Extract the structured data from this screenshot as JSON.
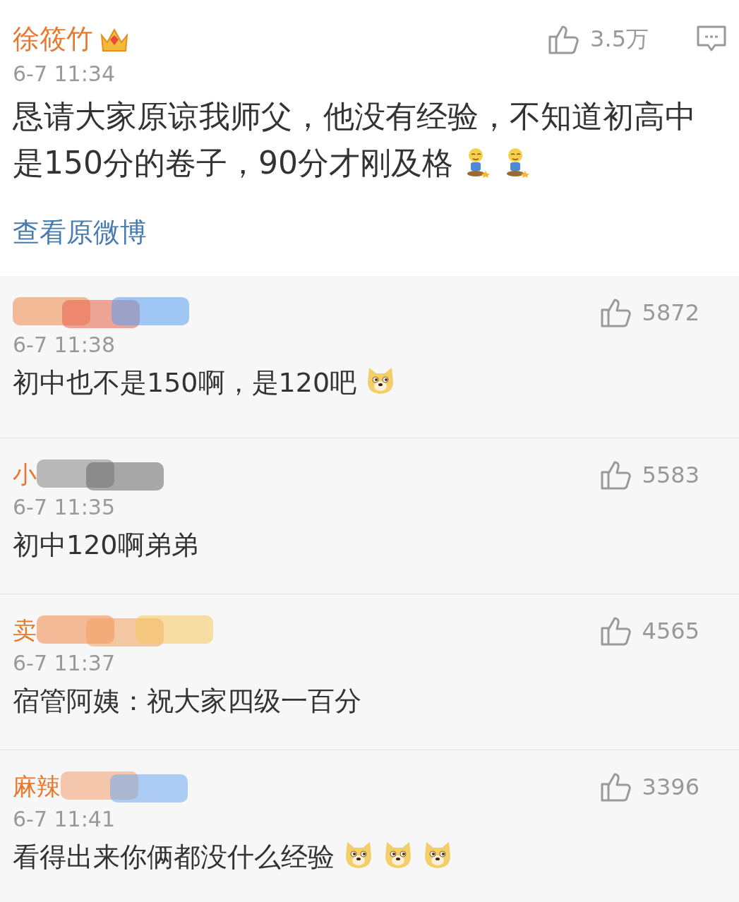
{
  "post": {
    "author": "徐筱竹",
    "time": "6-7 11:34",
    "likes": "3.5万",
    "text": "恳请大家原谅我师父，他没有经验，不知道初高中是150分的卷子，90分才刚及格",
    "emojis": [
      {
        "kind": "kneel"
      },
      {
        "kind": "kneel"
      }
    ],
    "link": "查看原微博"
  },
  "comments": [
    {
      "time": "6-7 11:38",
      "likes": "5872",
      "text": "初中也不是150啊，是120吧",
      "emojis": [
        {
          "kind": "doge"
        }
      ]
    },
    {
      "name_visible": "小",
      "time": "6-7 11:35",
      "likes": "5583",
      "text": "初中120啊弟弟"
    },
    {
      "name_visible": "卖",
      "time": "6-7 11:37",
      "likes": "4565",
      "text": "宿管阿姨：祝大家四级一百分"
    },
    {
      "name_visible": "麻辣",
      "time": "6-7 11:41",
      "likes": "3396",
      "text": "看得出来你俩都没什么经验",
      "emojis": [
        {
          "kind": "doge"
        },
        {
          "kind": "doge"
        },
        {
          "kind": "doge"
        }
      ]
    }
  ]
}
